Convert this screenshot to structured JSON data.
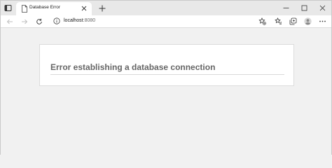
{
  "browser": {
    "tab": {
      "title": "Database Error"
    },
    "address_bar": {
      "host": "localhost",
      "port": ":8080"
    },
    "icons": {
      "tab_actions": "tab-actions-icon",
      "favicon": "page-icon",
      "close": "close-icon",
      "new_tab": "plus-icon",
      "minimize": "minimize-icon",
      "maximize": "maximize-icon",
      "window_close": "close-icon",
      "back": "back-arrow-icon",
      "forward": "forward-arrow-icon",
      "reload": "reload-icon",
      "site_info": "info-icon",
      "add_favorite": "star-plus-icon",
      "favorites": "favorites-icon",
      "collections": "collections-icon",
      "profile": "avatar-icon",
      "menu": "more-icon"
    }
  },
  "page": {
    "error_heading": "Error establishing a database connection"
  },
  "colors": {
    "background": "#f1f1f1",
    "card": "#ffffff",
    "heading": "#666666"
  }
}
